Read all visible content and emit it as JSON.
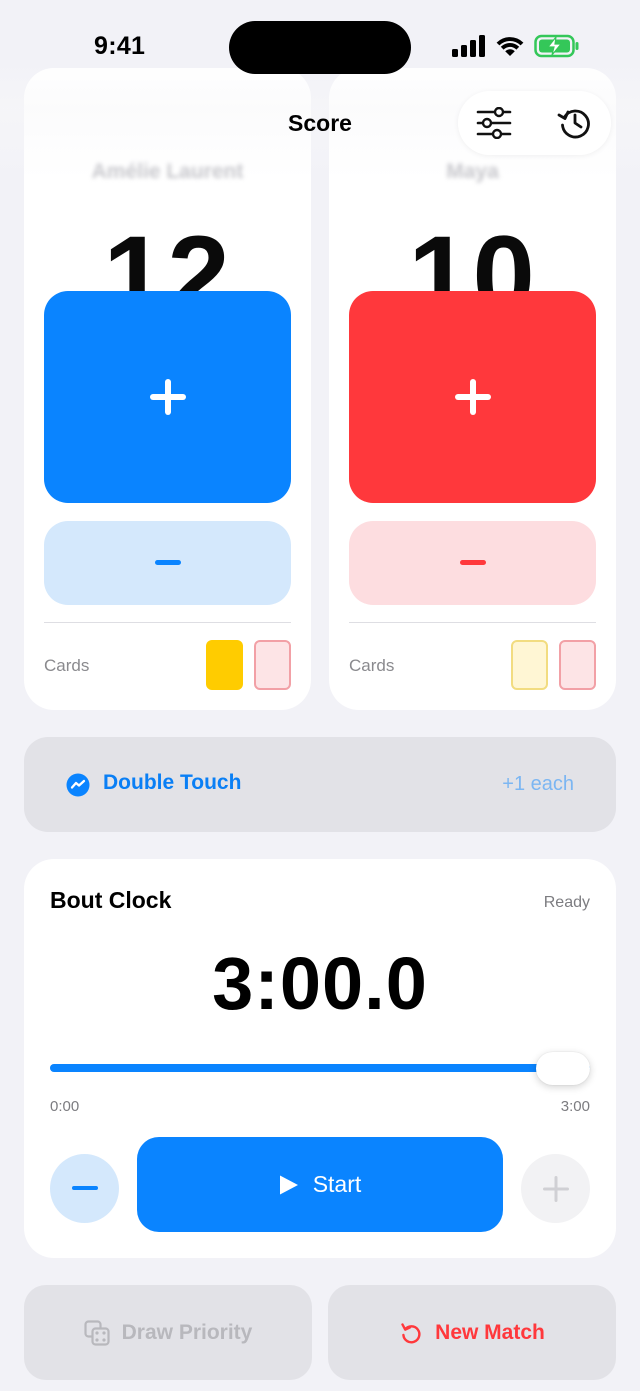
{
  "status_bar": {
    "time": "9:41"
  },
  "header": {
    "title": "Score"
  },
  "fencers": [
    {
      "name": "Amélie Laurent",
      "score": "12",
      "color": "#0a84ff",
      "cards": {
        "yellow": true,
        "red": false
      }
    },
    {
      "name": "Maya",
      "score": "10",
      "color": "#ff383c",
      "cards": {
        "yellow": false,
        "red": false
      }
    }
  ],
  "cards_label": "Cards",
  "double_touch": {
    "label": "Double Touch",
    "value": "+1 each"
  },
  "bout_clock": {
    "title": "Bout Clock",
    "status": "Ready",
    "time": "3:00.0",
    "progress": 1.0,
    "min_label": "0:00",
    "max_label": "3:00",
    "start_label": "Start"
  },
  "actions": {
    "draw_priority": "Draw Priority",
    "new_match": "New Match"
  },
  "icons": {
    "filters": "sliders-icon",
    "history": "history-icon",
    "double_touch": "double-touch-icon",
    "dice": "dice-icon",
    "reset": "reset-icon"
  }
}
